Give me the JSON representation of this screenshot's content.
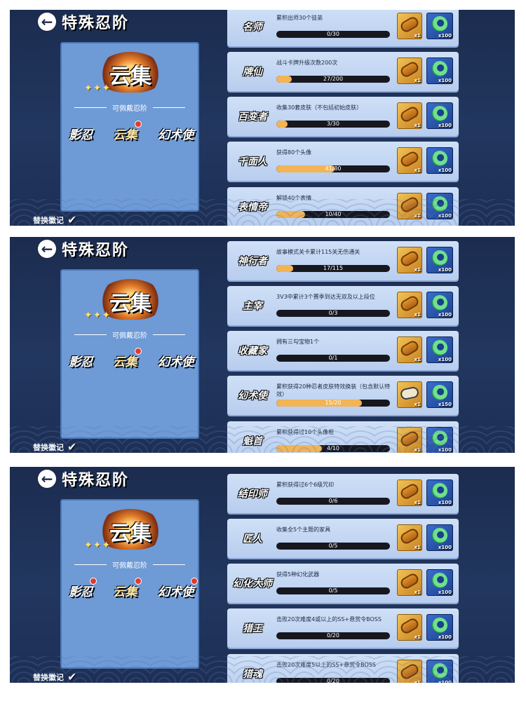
{
  "header": {
    "title": "特殊忍阶"
  },
  "left_panel": {
    "badge_text": "云集",
    "sublabel": "可佩戴忍阶",
    "ranks": [
      "影忍",
      "云集",
      "幻术使"
    ],
    "replace_label": "替换徽记"
  },
  "screens": [
    {
      "cards": [
        {
          "name": "名师",
          "desc": "累积出师30个徒弟",
          "progress_text": "0/30",
          "progress": 0,
          "reward1_qty": "x1",
          "reward2_qty": "x100"
        },
        {
          "name": "牌仙",
          "desc": "战斗卡牌升级次数200次",
          "progress_text": "27/200",
          "progress": 0.135,
          "reward1_qty": "x1",
          "reward2_qty": "x100"
        },
        {
          "name": "百变者",
          "desc": "收集30套皮肤（不包括初始皮肤）",
          "progress_text": "3/30",
          "progress": 0.1,
          "reward1_qty": "x1",
          "reward2_qty": "x100"
        },
        {
          "name": "千面人",
          "desc": "获得80个头像",
          "progress_text": "41/80",
          "progress": 0.5125,
          "reward1_qty": "x1",
          "reward2_qty": "x100"
        },
        {
          "name": "表情帝",
          "desc": "解锁40个表情",
          "progress_text": "10/40",
          "progress": 0.25,
          "reward1_qty": "x1",
          "reward2_qty": "x100"
        }
      ]
    },
    {
      "cards": [
        {
          "name": "神行者",
          "desc": "故事模式关卡累计115关无伤通关",
          "progress_text": "17/115",
          "progress": 0.148,
          "reward1_qty": "x1",
          "reward2_qty": "x100"
        },
        {
          "name": "主宰",
          "desc": "3V3中累计3个赛季到达无双及以上段位",
          "progress_text": "0/3",
          "progress": 0,
          "reward1_qty": "x1",
          "reward2_qty": "x100"
        },
        {
          "name": "收藏家",
          "desc": "拥有三勾宝物1个",
          "progress_text": "0/1",
          "progress": 0,
          "reward1_qty": "x1",
          "reward2_qty": "x100"
        },
        {
          "name": "幻术使",
          "desc": "累积获得20种忍者皮肤特效换装（包含默认特效）",
          "progress_text": "15/20",
          "progress": 0.75,
          "reward1_qty": "x1",
          "reward2_qty": "x150",
          "paper": true
        },
        {
          "name": "魁首",
          "desc": "累积获得过10个头像框",
          "progress_text": "4/10",
          "progress": 0.4,
          "reward1_qty": "x1",
          "reward2_qty": "x100"
        }
      ]
    },
    {
      "cards": [
        {
          "name": "结印师",
          "desc": "累积获得过6个6级咒印",
          "progress_text": "0/6",
          "progress": 0,
          "reward1_qty": "x1",
          "reward2_qty": "x100"
        },
        {
          "name": "匠人",
          "desc": "收集全5个主题的家具",
          "progress_text": "0/5",
          "progress": 0,
          "reward1_qty": "x1",
          "reward2_qty": "x100"
        },
        {
          "name": "幻化大师",
          "desc": "获得5种幻化武器",
          "progress_text": "0/5",
          "progress": 0,
          "reward1_qty": "x1",
          "reward2_qty": "x100"
        },
        {
          "name": "猎王",
          "desc": "击败20次难度4或以上的SS+悬赏令BOSS",
          "progress_text": "0/20",
          "progress": 0,
          "reward1_qty": "x1",
          "reward2_qty": "x100"
        },
        {
          "name": "猎魂",
          "desc": "击败20次难度5以上的SS+悬赏令BOSS",
          "progress_text": "0/20",
          "progress": 0,
          "reward1_qty": "x1",
          "reward2_qty": "x100"
        }
      ]
    }
  ]
}
